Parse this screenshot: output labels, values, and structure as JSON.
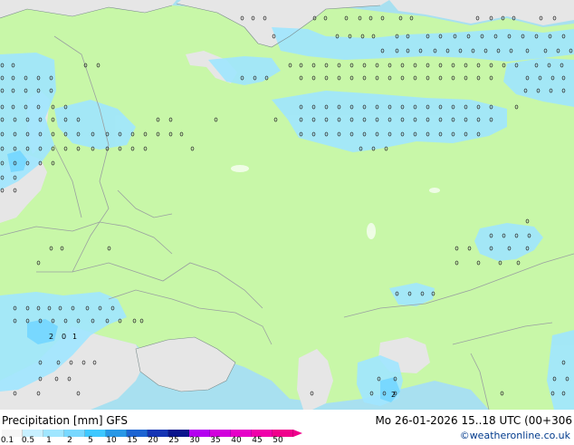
{
  "header": {
    "title_left": "Precipitation [mm]  GFS",
    "title_right": "Mo 26-01-2026 15..18 UTC (00+306"
  },
  "footer": {
    "credit": "©weatheronline.co.uk"
  },
  "legend": {
    "labels": [
      "0.1",
      "0.5",
      "1",
      "2",
      "5",
      "10",
      "15",
      "20",
      "25",
      "30",
      "35",
      "40",
      "45",
      "50"
    ],
    "colors": [
      "#f5f5f5",
      "#c8f0ff",
      "#a0e6ff",
      "#78d8ff",
      "#3ec8ff",
      "#2898e6",
      "#1c64d2",
      "#1434b4",
      "#0a148c",
      "#b400f0",
      "#d200dc",
      "#e600c8",
      "#f000aa",
      "#f0008c"
    ]
  },
  "colors": {
    "land": "#c8f7a8",
    "sea": "#a8e0f0",
    "no_data": "#e6e6e6",
    "light_precip": "#a0e6ff",
    "moderate_precip": "#78d8ff",
    "border": "#9aa0a0"
  },
  "map": {
    "precip_markers": [
      {
        "text": "2"
      },
      {
        "text": "1"
      },
      {
        "text": "0"
      },
      {
        "text": "2"
      }
    ]
  }
}
